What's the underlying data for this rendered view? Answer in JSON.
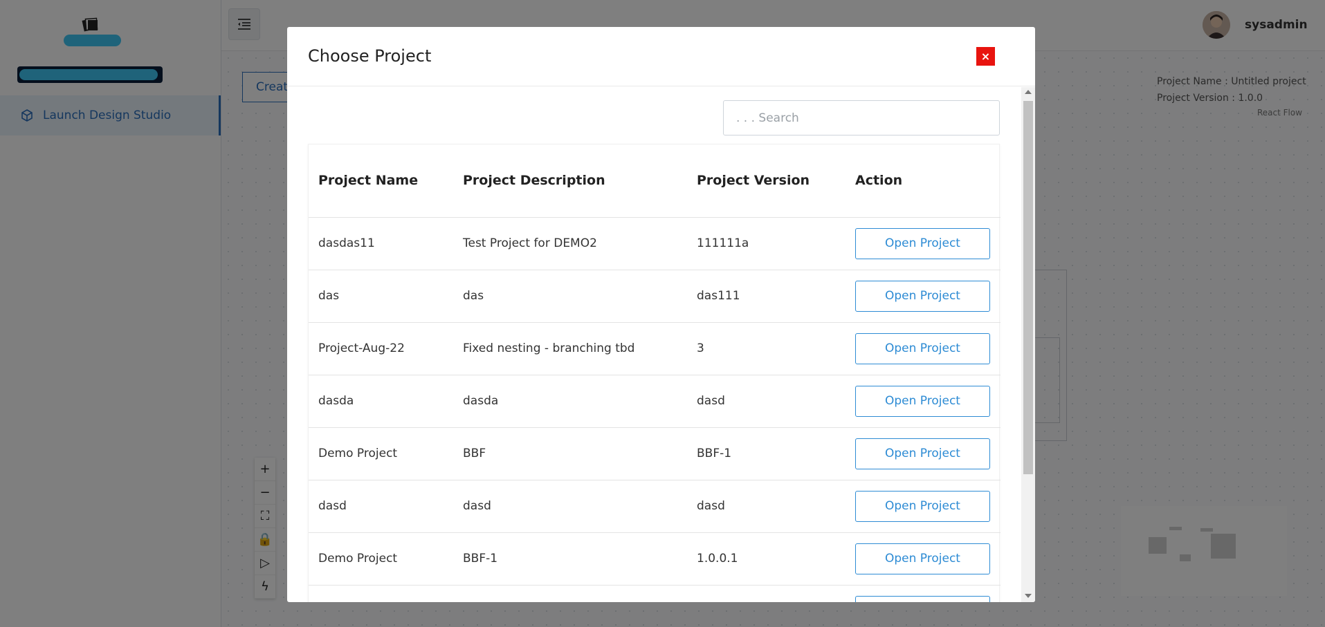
{
  "sidebar": {
    "nav_items": [
      {
        "label": "Launch Design Studio",
        "icon": "cube-icon"
      }
    ]
  },
  "topbar": {
    "menu_icon": "menu-indent-icon",
    "username": "sysadmin"
  },
  "canvas": {
    "create_label": "Creat",
    "project_name": "Project Name : Untitled project",
    "project_version": "Project Version : 1.0.0",
    "react_flow_label": "React Flow",
    "controls": [
      "plus-icon",
      "minus-icon",
      "fit-view-icon",
      "lock-icon",
      "play-icon",
      "bolt-icon"
    ]
  },
  "modal": {
    "title": "Choose Project",
    "close_label": "×",
    "search_placeholder": ". . . Search",
    "columns": [
      "Project Name",
      "Project Description",
      "Project Version",
      "Action"
    ],
    "action_label": "Open Project",
    "rows": [
      {
        "name": "dasdas11",
        "description": "Test Project for DEMO2",
        "version": "111111a"
      },
      {
        "name": "das",
        "description": "das",
        "version": "das111"
      },
      {
        "name": "Project-Aug-22",
        "description": "Fixed nesting - branching tbd",
        "version": "3"
      },
      {
        "name": "dasda",
        "description": "dasda",
        "version": "dasd"
      },
      {
        "name": "Demo Project",
        "description": "BBF",
        "version": "BBF-1"
      },
      {
        "name": "dasd",
        "description": "dasd",
        "version": "dasd"
      },
      {
        "name": "Demo Project",
        "description": "BBF-1",
        "version": "1.0.0.1"
      },
      {
        "name": "",
        "description": "",
        "version": ""
      }
    ]
  },
  "colors": {
    "accent": "#2d8bd4",
    "close": "#e8140f",
    "brand_cyan": "#3fc6f5"
  }
}
